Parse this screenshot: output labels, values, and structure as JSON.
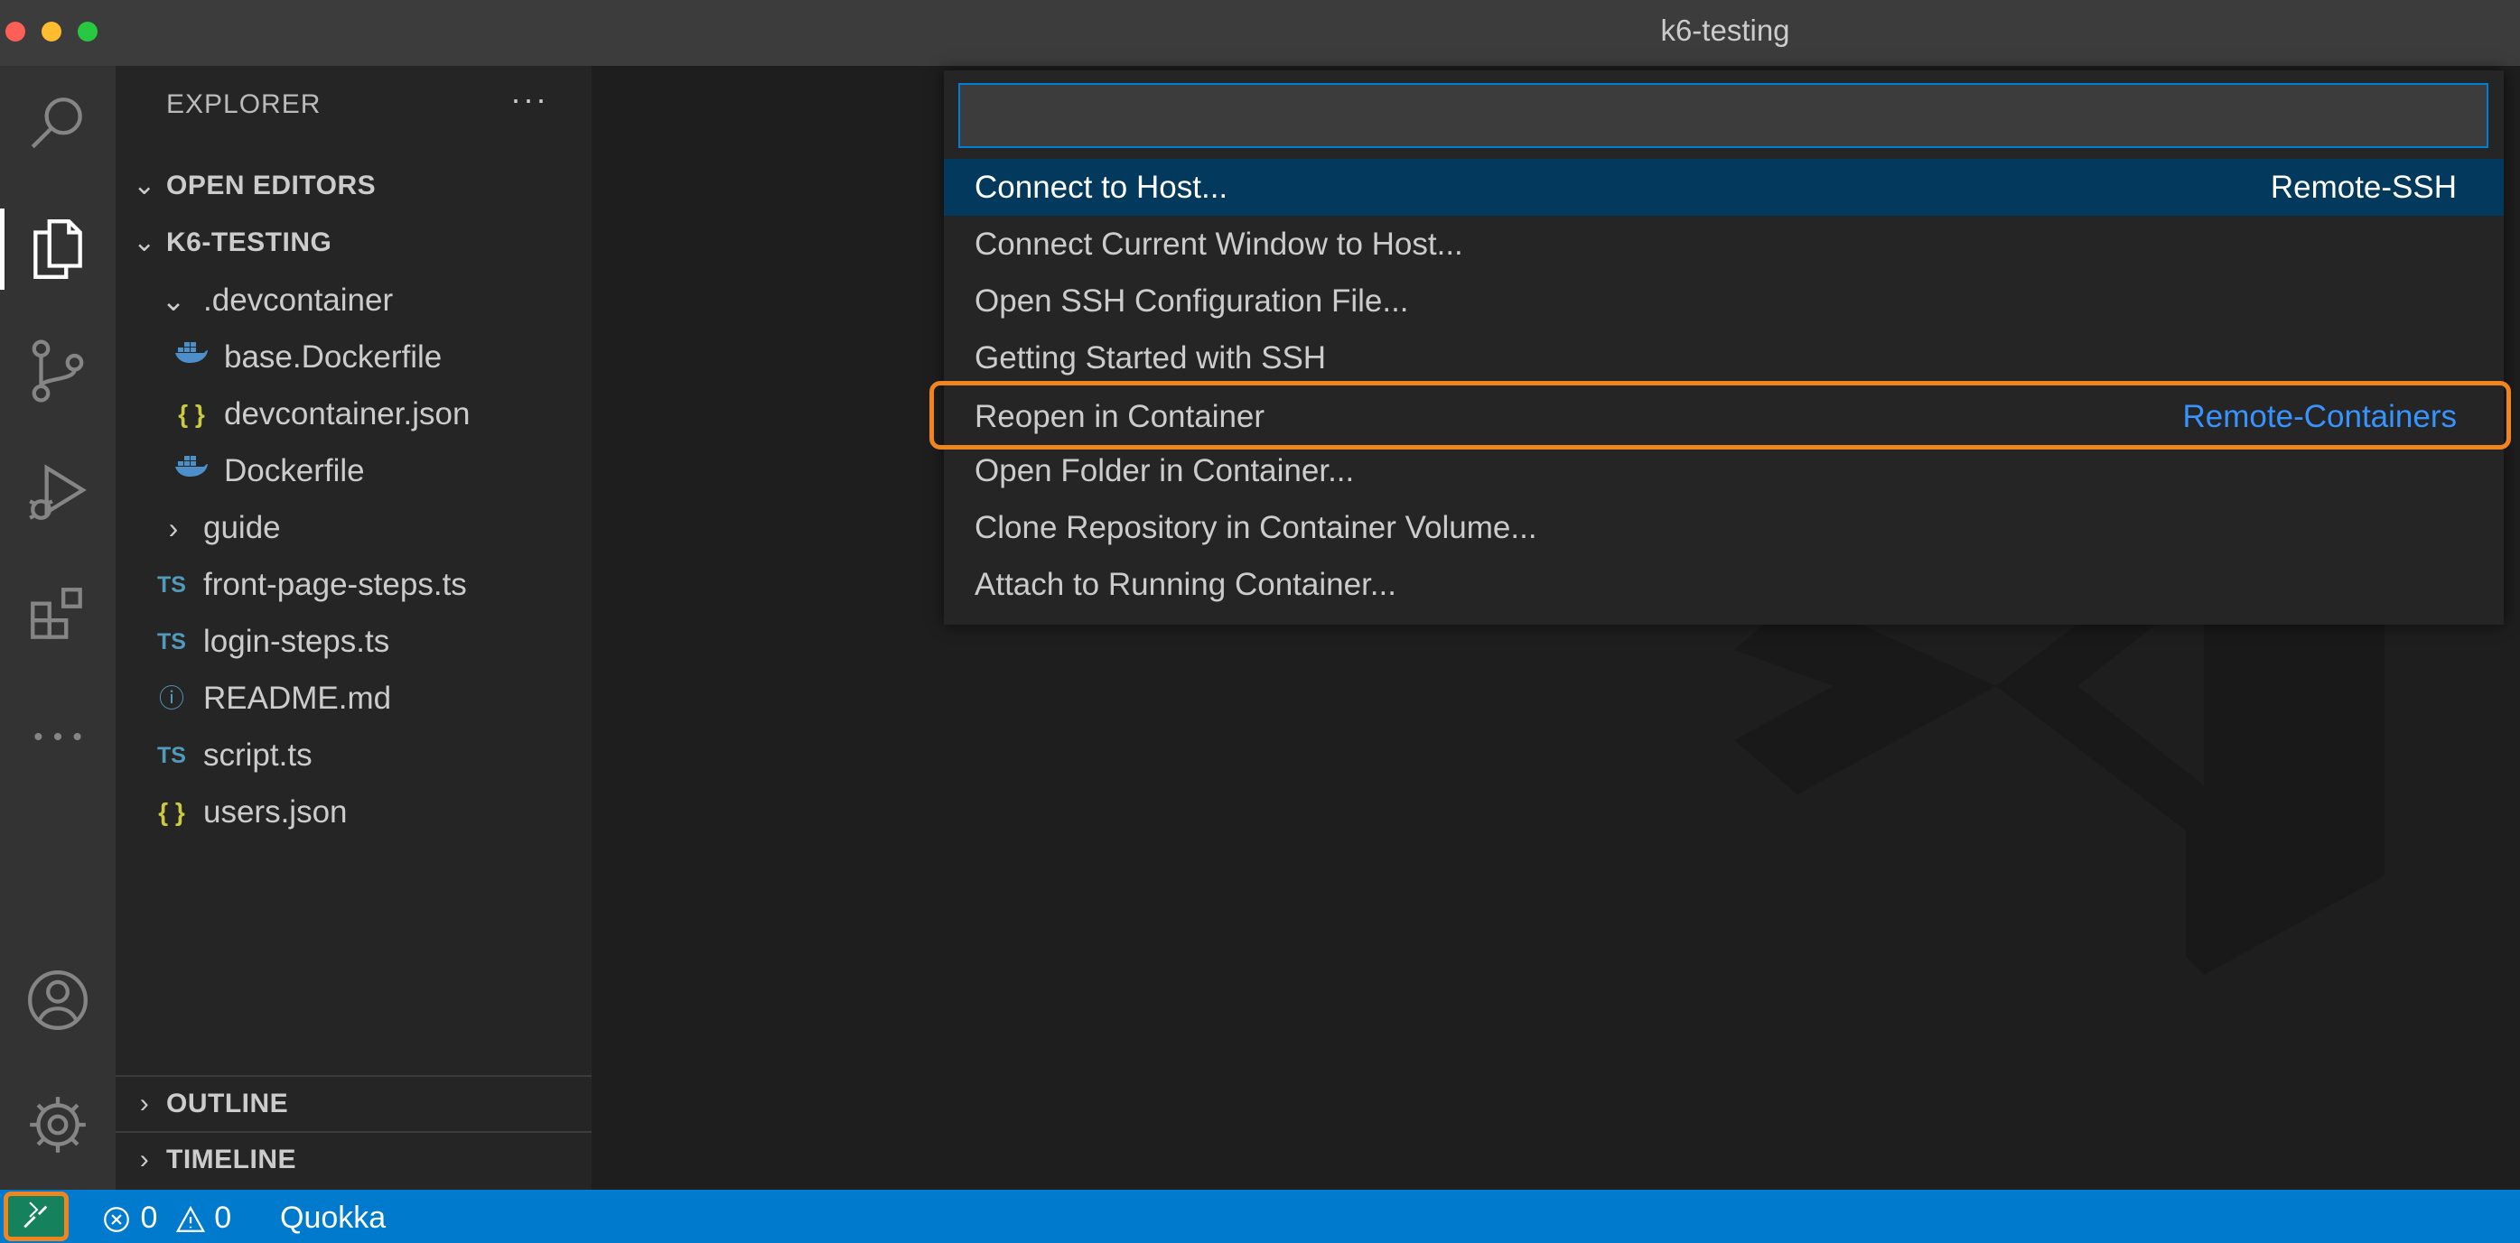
{
  "window": {
    "title": "k6-testing"
  },
  "activity_bar": {
    "items": [
      {
        "name": "search-icon"
      },
      {
        "name": "files-icon",
        "active": true
      },
      {
        "name": "source-control-icon"
      },
      {
        "name": "run-debug-icon"
      },
      {
        "name": "extensions-icon"
      },
      {
        "name": "more-icon"
      },
      {
        "name": "account-icon"
      },
      {
        "name": "gear-icon"
      }
    ]
  },
  "sidebar": {
    "header": "EXPLORER",
    "more": "···",
    "sections": {
      "open_editors": "OPEN EDITORS",
      "project": "K6-TESTING",
      "outline": "OUTLINE",
      "timeline": "TIMELINE"
    },
    "tree": [
      {
        "label": ".devcontainer",
        "icon": "chevron-down-icon"
      },
      {
        "label": "base.Dockerfile",
        "icon": "docker-icon"
      },
      {
        "label": "devcontainer.json",
        "icon": "json-icon"
      },
      {
        "label": "Dockerfile",
        "icon": "docker-icon"
      },
      {
        "label": "guide",
        "icon": "chevron-right-icon"
      },
      {
        "label": "front-page-steps.ts",
        "icon": "typescript-icon"
      },
      {
        "label": "login-steps.ts",
        "icon": "typescript-icon"
      },
      {
        "label": "README.md",
        "icon": "info-icon"
      },
      {
        "label": "script.ts",
        "icon": "typescript-icon"
      },
      {
        "label": "users.json",
        "icon": "json-icon"
      }
    ],
    "icon_glyphs": {
      "ts": "TS",
      "json": "{ }",
      "info": "ⓘ"
    }
  },
  "quick_pick": {
    "input_value": "",
    "items": [
      {
        "label": "Connect to Host...",
        "detail": "Remote-SSH",
        "selected": true
      },
      {
        "label": "Connect Current Window to Host...",
        "detail": ""
      },
      {
        "label": "Open SSH Configuration File...",
        "detail": ""
      },
      {
        "label": "Getting Started with SSH",
        "detail": ""
      },
      {
        "label": "Reopen in Container",
        "detail": "Remote-Containers",
        "highlighted": true
      },
      {
        "label": "Open Folder in Container...",
        "detail": ""
      },
      {
        "label": "Clone Repository in Container Volume...",
        "detail": ""
      },
      {
        "label": "Attach to Running Container...",
        "detail": ""
      }
    ]
  },
  "status_bar": {
    "errors": "0",
    "warnings": "0",
    "extension": "Quokka"
  },
  "colors": {
    "status_bar": "#007acc",
    "remote_button": "#16825d",
    "highlight": "#f0851f",
    "selection": "#04395e",
    "link": "#3794ff"
  }
}
